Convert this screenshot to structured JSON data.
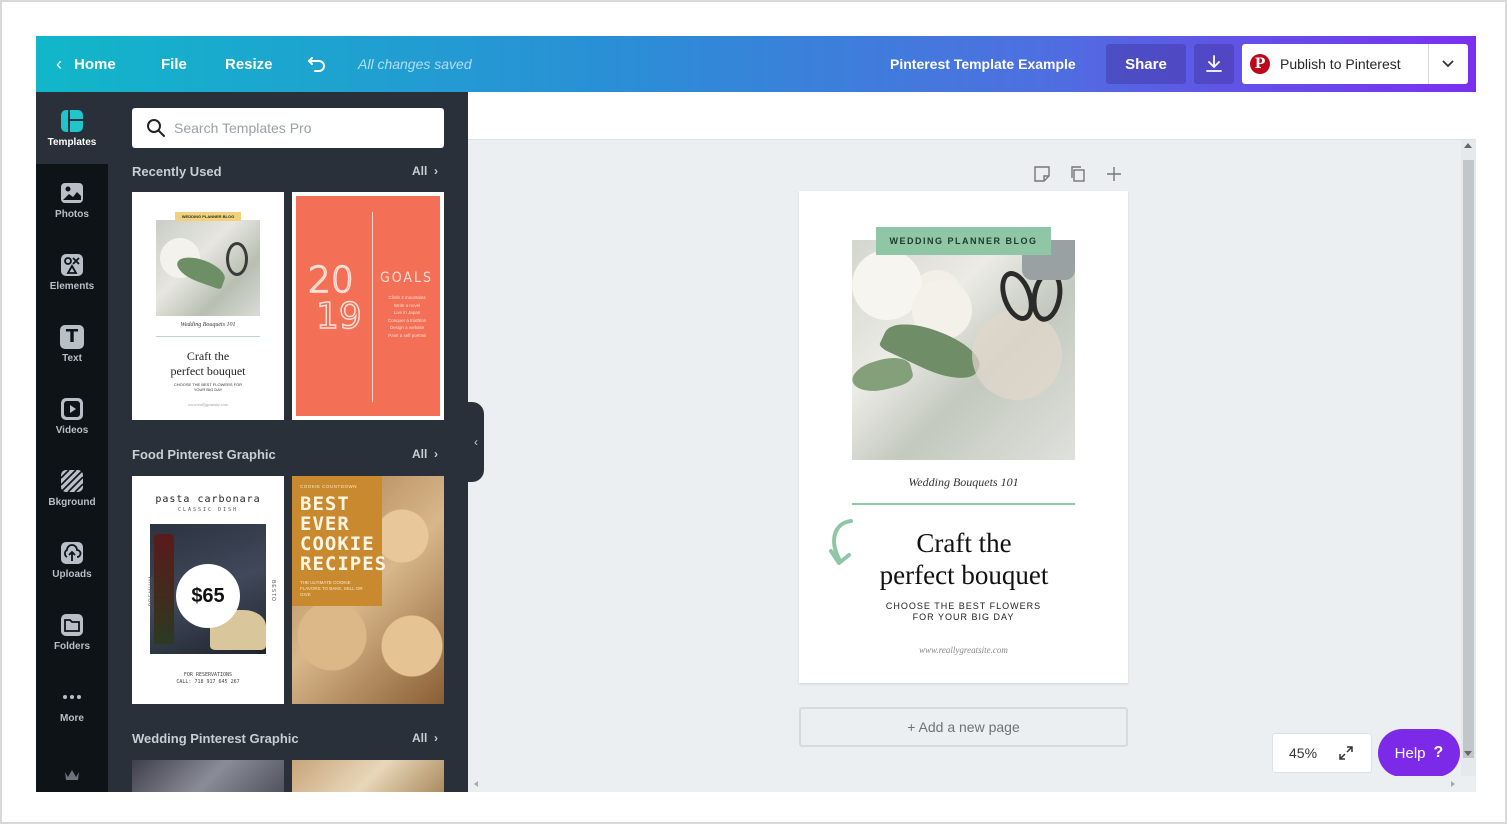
{
  "topbar": {
    "home": "Home",
    "file": "File",
    "resize": "Resize",
    "saved_status": "All changes saved",
    "doc_title": "Pinterest Template Example",
    "share": "Share",
    "publish": "Publish to Pinterest",
    "pinterest_letter": "P"
  },
  "rail": {
    "items": [
      {
        "label": "Templates",
        "icon": "templates-icon"
      },
      {
        "label": "Photos",
        "icon": "photos-icon"
      },
      {
        "label": "Elements",
        "icon": "elements-icon"
      },
      {
        "label": "Text",
        "icon": "text-icon"
      },
      {
        "label": "Videos",
        "icon": "videos-icon"
      },
      {
        "label": "Bkground",
        "icon": "background-icon"
      },
      {
        "label": "Uploads",
        "icon": "uploads-icon"
      },
      {
        "label": "Folders",
        "icon": "folders-icon"
      },
      {
        "label": "More",
        "icon": "more-icon"
      }
    ],
    "text_glyph": "T"
  },
  "panel": {
    "search_placeholder": "Search Templates Pro",
    "sections": [
      {
        "title": "Recently Used",
        "all": "All"
      },
      {
        "title": "Food Pinterest Graphic",
        "all": "All"
      },
      {
        "title": "Wedding Pinterest Graphic",
        "all": "All"
      }
    ],
    "thumb_wedding": {
      "tag": "WEDDING PLANNER BLOG",
      "sub": "Wedding Bouquets 101",
      "title1": "Craft the",
      "title2": "perfect bouquet",
      "tag2": "CHOOSE THE BEST FLOWERS FOR YOUR BIG DAY",
      "url": "www.reallygreatsite.com"
    },
    "thumb_goals": {
      "year1": "20",
      "year2": "19",
      "title": "GOALS",
      "lines": [
        "Climb 3 mountains",
        "Write a novel",
        "Live in Japan",
        "Conquer a triathlon",
        "Design a website",
        "Paint a self portrait"
      ]
    },
    "thumb_pasta": {
      "title": "pasta carbonara",
      "sub": "CLASSIC DISH",
      "price": "$65",
      "side_left": "PREMIUM",
      "side_right": "BESTO",
      "foot1": "FOR RESERVATIONS",
      "foot2": "CALL: 718 917 645 267"
    },
    "thumb_cookie": {
      "tag": "COOKIE COUNTDOWN",
      "title": "BEST EVER COOKIE RECIPES",
      "sub": "THE ULTIMATE COOKIE FLAVORS TO BAKE, SELL OR GIVE"
    }
  },
  "canvas": {
    "tag": "WEDDING PLANNER BLOG",
    "subtitle": "Wedding Bouquets 101",
    "title_line1": "Craft the",
    "title_line2": "perfect bouquet",
    "tagline1": "CHOOSE THE BEST FLOWERS",
    "tagline2": "FOR YOUR BIG DAY",
    "url": "www.reallygreatsite.com",
    "add_page": "+ Add a new page",
    "zoom": "45%",
    "help": "Help",
    "help_q": "?"
  },
  "colors": {
    "brand_purple": "#7d2ae8",
    "accent_green": "#8fc6a5",
    "goals_coral": "#f36f56",
    "cookie_orange": "#c9892e",
    "pinterest_red": "#bd081c"
  }
}
